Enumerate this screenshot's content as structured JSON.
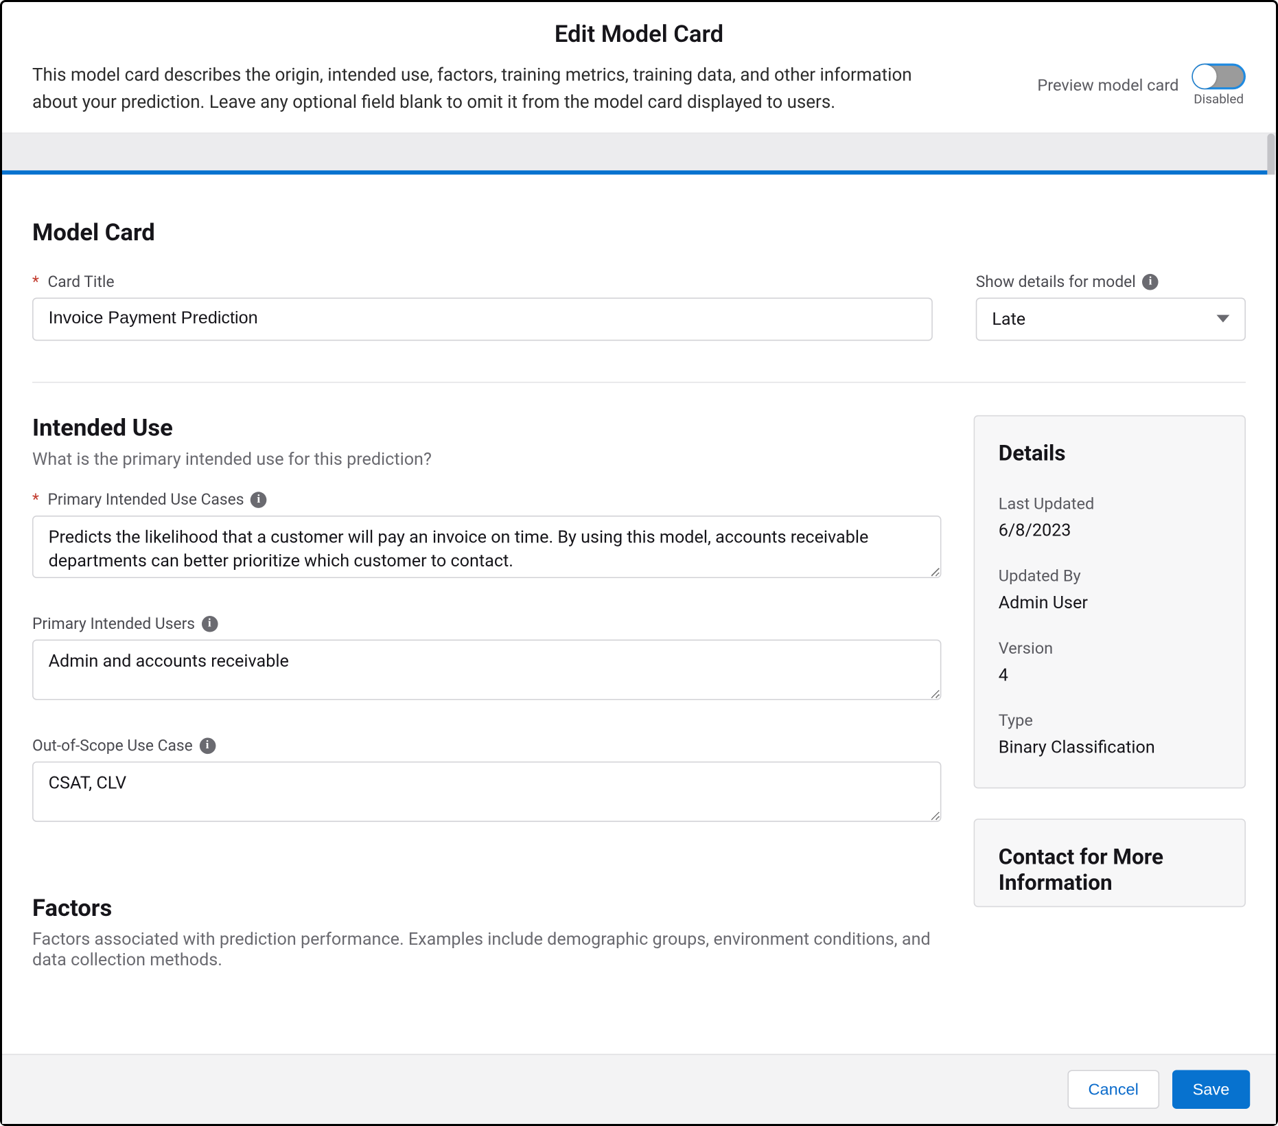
{
  "dialog": {
    "title": "Edit Model Card"
  },
  "header": {
    "description": "This model card describes the origin, intended use, factors, training metrics, training data, and other information about your prediction. Leave any optional field blank to omit it from the model card displayed to users.",
    "preview_label": "Preview model card",
    "toggle_state": "Disabled"
  },
  "modelcard": {
    "section_title": "Model Card",
    "card_title_label": "Card Title",
    "card_title_value": "Invoice Payment Prediction",
    "show_details_label": "Show details for model",
    "show_details_selected": "Late"
  },
  "intended": {
    "section_title": "Intended Use",
    "subtitle": "What is the primary intended use for this prediction?",
    "primary_use_label": "Primary Intended Use Cases",
    "primary_use_value": "Predicts the likelihood that a customer will pay an invoice on time. By using this model, accounts receivable departments can better prioritize which customer to contact.",
    "primary_users_label": "Primary Intended Users",
    "primary_users_value": "Admin and accounts receivable",
    "out_of_scope_label": "Out-of-Scope Use Case",
    "out_of_scope_value": "CSAT, CLV"
  },
  "factors": {
    "section_title": "Factors",
    "subtitle": "Factors associated with prediction performance. Examples include demographic groups, environment conditions, and data collection methods."
  },
  "details": {
    "panel_title": "Details",
    "last_updated_label": "Last Updated",
    "last_updated_value": "6/8/2023",
    "updated_by_label": "Updated By",
    "updated_by_value": "Admin User",
    "version_label": "Version",
    "version_value": "4",
    "type_label": "Type",
    "type_value": "Binary Classification"
  },
  "contact": {
    "panel_title": "Contact for More Information"
  },
  "footer": {
    "cancel": "Cancel",
    "save": "Save"
  }
}
